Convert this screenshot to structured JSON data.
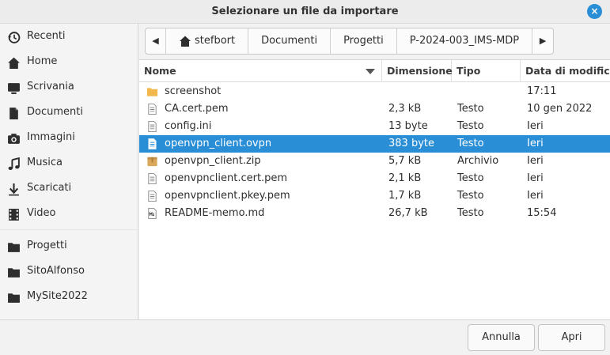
{
  "dialog": {
    "title": "Selezionare un file da importare",
    "close_label": "×"
  },
  "sidebar": {
    "items": [
      {
        "label": "Recenti",
        "icon": "recent-icon"
      },
      {
        "label": "Home",
        "icon": "home-icon"
      },
      {
        "label": "Scrivania",
        "icon": "desktop-icon"
      },
      {
        "label": "Documenti",
        "icon": "document-icon"
      },
      {
        "label": "Immagini",
        "icon": "camera-icon"
      },
      {
        "label": "Musica",
        "icon": "music-icon"
      },
      {
        "label": "Scaricati",
        "icon": "download-icon"
      },
      {
        "label": "Video",
        "icon": "film-icon"
      },
      {
        "label": "Progetti",
        "icon": "folder-icon"
      },
      {
        "label": "SitoAlfonso",
        "icon": "folder-icon"
      },
      {
        "label": "MySite2022",
        "icon": "folder-icon"
      }
    ]
  },
  "pathbar": {
    "back_label": "◀",
    "forward_label": "▶",
    "crumbs": [
      "stefbort",
      "Documenti",
      "Progetti",
      "P-2024-003_IMS-MDP"
    ]
  },
  "filelist": {
    "columns": {
      "name": "Nome",
      "size": "Dimensione",
      "type": "Tipo",
      "modified": "Data di modifica"
    },
    "rows": [
      {
        "name": "screenshot",
        "size": "",
        "type": "",
        "modified": "17:11",
        "icon": "folder-icon",
        "selected": false
      },
      {
        "name": "CA.cert.pem",
        "size": "2,3 kB",
        "type": "Testo",
        "modified": "10 gen 2022",
        "icon": "text-file-icon",
        "selected": false
      },
      {
        "name": "config.ini",
        "size": "13 byte",
        "type": "Testo",
        "modified": "Ieri",
        "icon": "text-file-icon",
        "selected": false
      },
      {
        "name": "openvpn_client.ovpn",
        "size": "383 byte",
        "type": "Testo",
        "modified": "Ieri",
        "icon": "text-file-icon",
        "selected": true
      },
      {
        "name": "openvpn_client.zip",
        "size": "5,7 kB",
        "type": "Archivio",
        "modified": "Ieri",
        "icon": "archive-icon",
        "selected": false
      },
      {
        "name": "openvpnclient.cert.pem",
        "size": "2,1 kB",
        "type": "Testo",
        "modified": "Ieri",
        "icon": "text-file-icon",
        "selected": false
      },
      {
        "name": "openvpnclient.pkey.pem",
        "size": "1,7 kB",
        "type": "Testo",
        "modified": "Ieri",
        "icon": "text-file-icon",
        "selected": false
      },
      {
        "name": "README-memo.md",
        "size": "26,7 kB",
        "type": "Testo",
        "modified": "15:54",
        "icon": "markdown-file-icon",
        "selected": false
      }
    ]
  },
  "footer": {
    "cancel_label": "Annulla",
    "open_label": "Apri"
  },
  "colors": {
    "accent": "#2a8ed6",
    "folder": "#f2b84b",
    "archive": "#d9a85a"
  }
}
